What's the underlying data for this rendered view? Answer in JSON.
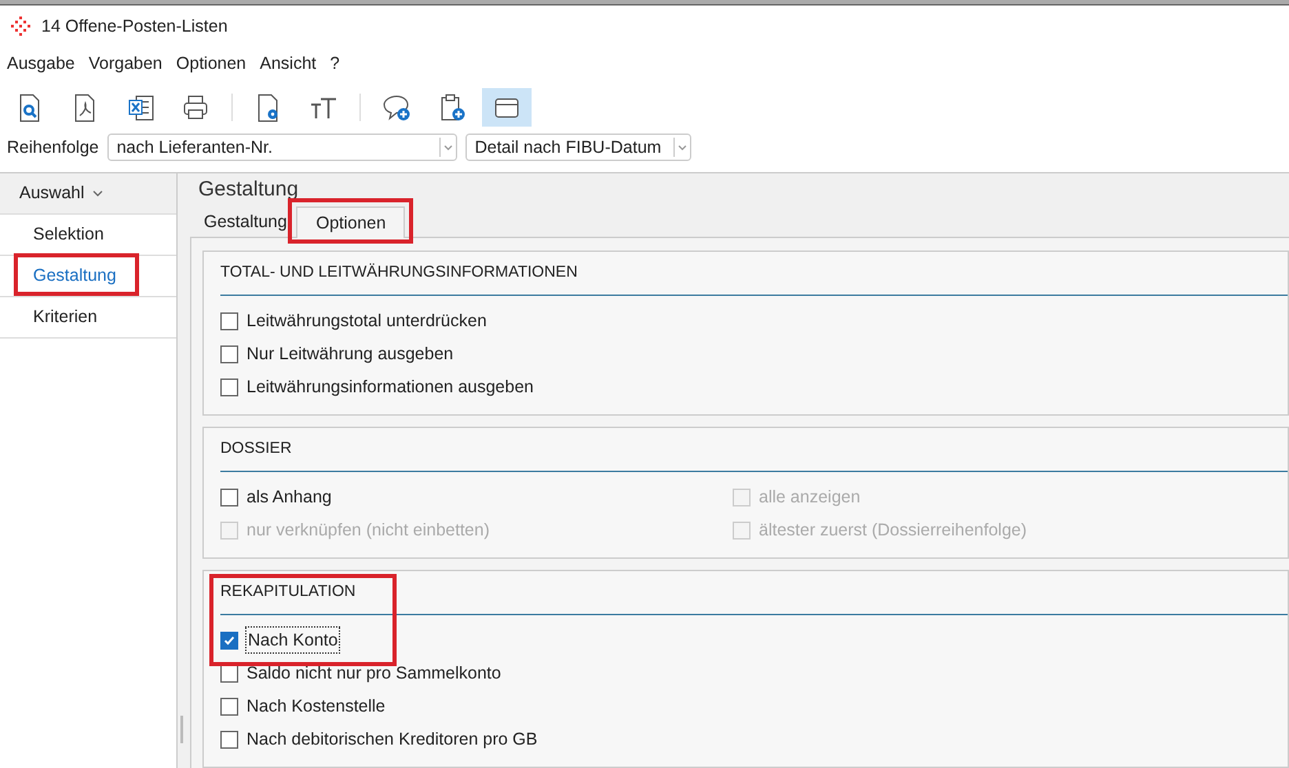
{
  "window": {
    "title": "14 Offene-Posten-Listen"
  },
  "menu": [
    {
      "label": "Ausgabe"
    },
    {
      "label": "Vorgaben"
    },
    {
      "label": "Optionen"
    },
    {
      "label": "Ansicht"
    },
    {
      "label": "?"
    }
  ],
  "toolbar": [
    {
      "kind": "preview",
      "selected": false
    },
    {
      "kind": "pdf",
      "selected": false
    },
    {
      "kind": "excel",
      "selected": false
    },
    {
      "kind": "print",
      "selected": false
    },
    {
      "kind": "separator"
    },
    {
      "kind": "page-settings",
      "selected": false
    },
    {
      "kind": "font",
      "selected": false
    },
    {
      "kind": "separator"
    },
    {
      "kind": "comment-add",
      "selected": false
    },
    {
      "kind": "clipboard-add",
      "selected": false
    },
    {
      "kind": "window",
      "selected": true
    }
  ],
  "order_bar": {
    "label": "Reihenfolge",
    "sort": "nach Lieferanten-Nr.",
    "detail": "Detail nach FIBU-Datum"
  },
  "sidebar": {
    "header": "Auswahl",
    "items": [
      {
        "label": "Selektion",
        "selected": false,
        "highlighted": false
      },
      {
        "label": "Gestaltung",
        "selected": true,
        "highlighted": true
      },
      {
        "label": "Kriterien",
        "selected": false,
        "highlighted": false
      }
    ]
  },
  "content": {
    "title": "Gestaltung",
    "tabs": [
      {
        "label": "Gestaltung",
        "selected": false,
        "highlighted": false
      },
      {
        "label": "Optionen",
        "selected": true,
        "highlighted": true
      }
    ],
    "sections": [
      {
        "title": "TOTAL- UND LEITWÄHRUNGSINFORMATIONEN",
        "kind": "list",
        "highlighted": false,
        "options": [
          {
            "label": "Leitwährungstotal unterdrücken",
            "checked": false,
            "disabled": false,
            "focused": false
          },
          {
            "label": "Nur Leitwährung ausgeben",
            "checked": false,
            "disabled": false,
            "focused": false
          },
          {
            "label": "Leitwährungsinformationen ausgeben",
            "checked": false,
            "disabled": false,
            "focused": false
          }
        ]
      },
      {
        "title": "DOSSIER",
        "kind": "two-column",
        "highlighted": false,
        "options": [
          {
            "label": "als Anhang",
            "checked": false,
            "disabled": false,
            "focused": false
          },
          {
            "label": "alle anzeigen",
            "checked": false,
            "disabled": true,
            "focused": false
          },
          {
            "label": "nur verknüpfen (nicht einbetten)",
            "checked": false,
            "disabled": true,
            "focused": false
          },
          {
            "label": "ältester zuerst (Dossierreihenfolge)",
            "checked": false,
            "disabled": true,
            "focused": false
          }
        ]
      },
      {
        "title": "REKAPITULATION",
        "kind": "list",
        "highlighted": true,
        "options": [
          {
            "label": "Nach Konto",
            "checked": true,
            "disabled": false,
            "focused": true
          },
          {
            "label": "Saldo nicht nur pro Sammelkonto",
            "checked": false,
            "disabled": false,
            "focused": false
          },
          {
            "label": "Nach Kostenstelle",
            "checked": false,
            "disabled": false,
            "focused": false
          },
          {
            "label": "Nach debitorischen Kreditoren pro GB",
            "checked": false,
            "disabled": false,
            "focused": false
          }
        ]
      }
    ]
  }
}
